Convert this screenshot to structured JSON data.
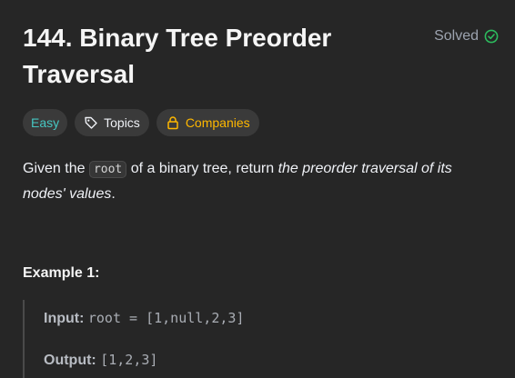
{
  "problem": {
    "title": "144. Binary Tree Preorder Traversal",
    "status": "Solved",
    "status_color": "#2cbb5d"
  },
  "tags": {
    "difficulty": "Easy",
    "topics": "Topics",
    "companies": "Companies"
  },
  "description": {
    "prefix": "Given the",
    "code": "root",
    "middle": "of a binary tree, return",
    "emphasis": "the preorder traversal of its nodes' values",
    "suffix": "."
  },
  "example": {
    "title": "Example 1:",
    "input_label": "Input:",
    "input_value": "root = [1,null,2,3]",
    "output_label": "Output:",
    "output_value": "[1,2,3]"
  }
}
